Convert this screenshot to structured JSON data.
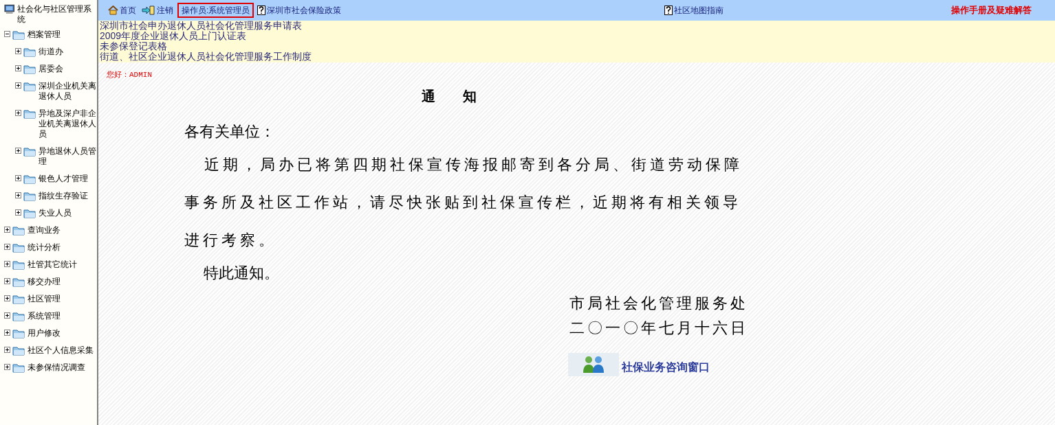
{
  "sidebar": {
    "root": {
      "label": "社会化与社区管理系统",
      "children": [
        {
          "label": "档案管理",
          "expanded": true,
          "children": [
            {
              "label": "街道办",
              "expanded": false
            },
            {
              "label": "居委会",
              "expanded": false
            },
            {
              "label": "深圳企业机关离退休人员",
              "expanded": false
            },
            {
              "label": "异地及深户非企业机关离退休人员",
              "expanded": false
            },
            {
              "label": "异地退休人员管理",
              "expanded": false
            },
            {
              "label": "银色人才管理",
              "expanded": false
            },
            {
              "label": "指纹生存验证",
              "expanded": false
            },
            {
              "label": "失业人员",
              "expanded": false
            }
          ]
        },
        {
          "label": "查询业务",
          "expanded": false
        },
        {
          "label": "统计分析",
          "expanded": false
        },
        {
          "label": "社管其它统计",
          "expanded": false
        },
        {
          "label": "移交办理",
          "expanded": false
        },
        {
          "label": "社区管理",
          "expanded": false
        },
        {
          "label": "系统管理",
          "expanded": false
        },
        {
          "label": "用户修改",
          "expanded": false
        },
        {
          "label": "社区个人信息采集",
          "expanded": false
        },
        {
          "label": "未参保情况调查",
          "expanded": false
        }
      ]
    }
  },
  "top_nav": {
    "items": [
      {
        "kind": "home",
        "label": "首页"
      },
      {
        "kind": "logout",
        "label": "注销"
      },
      {
        "kind": "operator",
        "label": "操作员:系统管理员"
      },
      {
        "kind": "help",
        "label": "深圳市社会保险政策"
      },
      {
        "kind": "help",
        "label": "社区地图指南"
      },
      {
        "kind": "manual",
        "label": "操作手册及疑难解答"
      }
    ]
  },
  "document_links": [
    "深圳市社会申办退休人员社会化管理服务申请表",
    "2009年度企业退休人员上门认证表",
    "未参保登记表格",
    "街道、社区企业退休人员社会化管理服务工作制度"
  ],
  "greeting": "您好：ADMIN",
  "notice": {
    "title": "通　　知",
    "salutation": "各有关单位：",
    "body": "近期，局办已将第四期社保宣传海报邮寄到各分局、街道劳动保障事务所及社区工作站，请尽快张贴到社保宣传栏，近期将有相关领导进行考察。",
    "closing": "特此通知。",
    "issuer": "市局社会化管理服务处",
    "date": "二〇一〇年七月十六日"
  },
  "consult_link": "社保业务咨询窗口"
}
